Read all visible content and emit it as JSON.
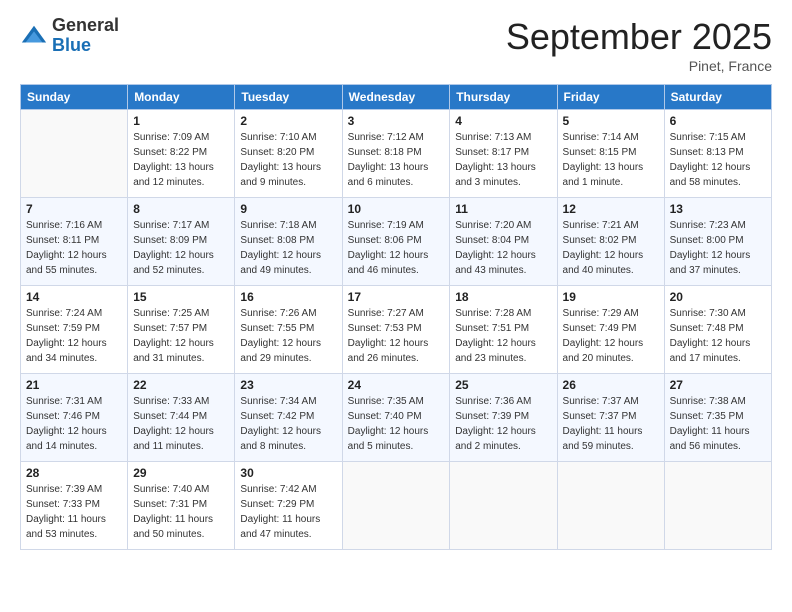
{
  "logo": {
    "general": "General",
    "blue": "Blue"
  },
  "header": {
    "title": "September 2025",
    "location": "Pinet, France"
  },
  "columns": [
    "Sunday",
    "Monday",
    "Tuesday",
    "Wednesday",
    "Thursday",
    "Friday",
    "Saturday"
  ],
  "weeks": [
    [
      {
        "day": "",
        "info": ""
      },
      {
        "day": "1",
        "info": "Sunrise: 7:09 AM\nSunset: 8:22 PM\nDaylight: 13 hours\nand 12 minutes."
      },
      {
        "day": "2",
        "info": "Sunrise: 7:10 AM\nSunset: 8:20 PM\nDaylight: 13 hours\nand 9 minutes."
      },
      {
        "day": "3",
        "info": "Sunrise: 7:12 AM\nSunset: 8:18 PM\nDaylight: 13 hours\nand 6 minutes."
      },
      {
        "day": "4",
        "info": "Sunrise: 7:13 AM\nSunset: 8:17 PM\nDaylight: 13 hours\nand 3 minutes."
      },
      {
        "day": "5",
        "info": "Sunrise: 7:14 AM\nSunset: 8:15 PM\nDaylight: 13 hours\nand 1 minute."
      },
      {
        "day": "6",
        "info": "Sunrise: 7:15 AM\nSunset: 8:13 PM\nDaylight: 12 hours\nand 58 minutes."
      }
    ],
    [
      {
        "day": "7",
        "info": "Sunrise: 7:16 AM\nSunset: 8:11 PM\nDaylight: 12 hours\nand 55 minutes."
      },
      {
        "day": "8",
        "info": "Sunrise: 7:17 AM\nSunset: 8:09 PM\nDaylight: 12 hours\nand 52 minutes."
      },
      {
        "day": "9",
        "info": "Sunrise: 7:18 AM\nSunset: 8:08 PM\nDaylight: 12 hours\nand 49 minutes."
      },
      {
        "day": "10",
        "info": "Sunrise: 7:19 AM\nSunset: 8:06 PM\nDaylight: 12 hours\nand 46 minutes."
      },
      {
        "day": "11",
        "info": "Sunrise: 7:20 AM\nSunset: 8:04 PM\nDaylight: 12 hours\nand 43 minutes."
      },
      {
        "day": "12",
        "info": "Sunrise: 7:21 AM\nSunset: 8:02 PM\nDaylight: 12 hours\nand 40 minutes."
      },
      {
        "day": "13",
        "info": "Sunrise: 7:23 AM\nSunset: 8:00 PM\nDaylight: 12 hours\nand 37 minutes."
      }
    ],
    [
      {
        "day": "14",
        "info": "Sunrise: 7:24 AM\nSunset: 7:59 PM\nDaylight: 12 hours\nand 34 minutes."
      },
      {
        "day": "15",
        "info": "Sunrise: 7:25 AM\nSunset: 7:57 PM\nDaylight: 12 hours\nand 31 minutes."
      },
      {
        "day": "16",
        "info": "Sunrise: 7:26 AM\nSunset: 7:55 PM\nDaylight: 12 hours\nand 29 minutes."
      },
      {
        "day": "17",
        "info": "Sunrise: 7:27 AM\nSunset: 7:53 PM\nDaylight: 12 hours\nand 26 minutes."
      },
      {
        "day": "18",
        "info": "Sunrise: 7:28 AM\nSunset: 7:51 PM\nDaylight: 12 hours\nand 23 minutes."
      },
      {
        "day": "19",
        "info": "Sunrise: 7:29 AM\nSunset: 7:49 PM\nDaylight: 12 hours\nand 20 minutes."
      },
      {
        "day": "20",
        "info": "Sunrise: 7:30 AM\nSunset: 7:48 PM\nDaylight: 12 hours\nand 17 minutes."
      }
    ],
    [
      {
        "day": "21",
        "info": "Sunrise: 7:31 AM\nSunset: 7:46 PM\nDaylight: 12 hours\nand 14 minutes."
      },
      {
        "day": "22",
        "info": "Sunrise: 7:33 AM\nSunset: 7:44 PM\nDaylight: 12 hours\nand 11 minutes."
      },
      {
        "day": "23",
        "info": "Sunrise: 7:34 AM\nSunset: 7:42 PM\nDaylight: 12 hours\nand 8 minutes."
      },
      {
        "day": "24",
        "info": "Sunrise: 7:35 AM\nSunset: 7:40 PM\nDaylight: 12 hours\nand 5 minutes."
      },
      {
        "day": "25",
        "info": "Sunrise: 7:36 AM\nSunset: 7:39 PM\nDaylight: 12 hours\nand 2 minutes."
      },
      {
        "day": "26",
        "info": "Sunrise: 7:37 AM\nSunset: 7:37 PM\nDaylight: 11 hours\nand 59 minutes."
      },
      {
        "day": "27",
        "info": "Sunrise: 7:38 AM\nSunset: 7:35 PM\nDaylight: 11 hours\nand 56 minutes."
      }
    ],
    [
      {
        "day": "28",
        "info": "Sunrise: 7:39 AM\nSunset: 7:33 PM\nDaylight: 11 hours\nand 53 minutes."
      },
      {
        "day": "29",
        "info": "Sunrise: 7:40 AM\nSunset: 7:31 PM\nDaylight: 11 hours\nand 50 minutes."
      },
      {
        "day": "30",
        "info": "Sunrise: 7:42 AM\nSunset: 7:29 PM\nDaylight: 11 hours\nand 47 minutes."
      },
      {
        "day": "",
        "info": ""
      },
      {
        "day": "",
        "info": ""
      },
      {
        "day": "",
        "info": ""
      },
      {
        "day": "",
        "info": ""
      }
    ]
  ]
}
